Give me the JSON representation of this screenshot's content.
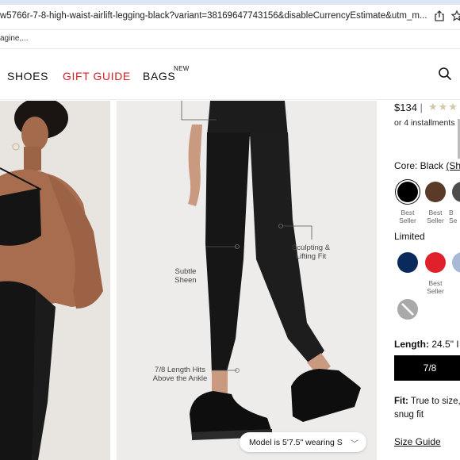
{
  "browser": {
    "url": "w5766r-7-8-high-waist-airlift-legging-black?variant=38169647743156&disableCurrencyEstimate&utm_m...",
    "bookmark": "agine,..."
  },
  "nav": {
    "items": [
      {
        "label": "SHOES"
      },
      {
        "label": "GIFT GUIDE",
        "color": "#d4202a"
      },
      {
        "label": "BAGS",
        "badge": "NEW"
      }
    ]
  },
  "product_image": {
    "callouts": {
      "subtle_sheen": "Subtle\nSheen",
      "sculpting": "Sculpting &\nLifting Fit",
      "length_hits": "7/8 Length Hits\nAbove the Ankle"
    },
    "model_pill": "Model is 5'7.5\" wearing S"
  },
  "product": {
    "price": "$134",
    "price_separator": "|",
    "rating_stars": "★★★",
    "installments": "or 4 installments",
    "core_color_label": "Core: Black",
    "core_color_link": "(Sh",
    "core_swatches": [
      {
        "color": "#000000",
        "tag": "Best\nSeller",
        "selected": true
      },
      {
        "color": "#5a3a28",
        "tag": "Best\nSeller"
      },
      {
        "color": "#4d4d4d",
        "tag": "B\nSe"
      }
    ],
    "limited_label": "Limited",
    "limited_swatches": [
      {
        "color": "#0b2a5c",
        "tag": ""
      },
      {
        "color": "#e0202a",
        "tag": "Best\nSeller"
      },
      {
        "color": "#a8b9d6",
        "tag": ""
      },
      {
        "color": "#a9a9a9",
        "tag": ""
      }
    ],
    "length_label": "Length:",
    "length_value": "24.5\" I",
    "length_option": "7/8",
    "fit_label": "Fit:",
    "fit_text": "True to size, snug fit",
    "size_guide": "Size Guide"
  },
  "colors": {
    "accent_red": "#d4202a",
    "black": "#000000"
  }
}
